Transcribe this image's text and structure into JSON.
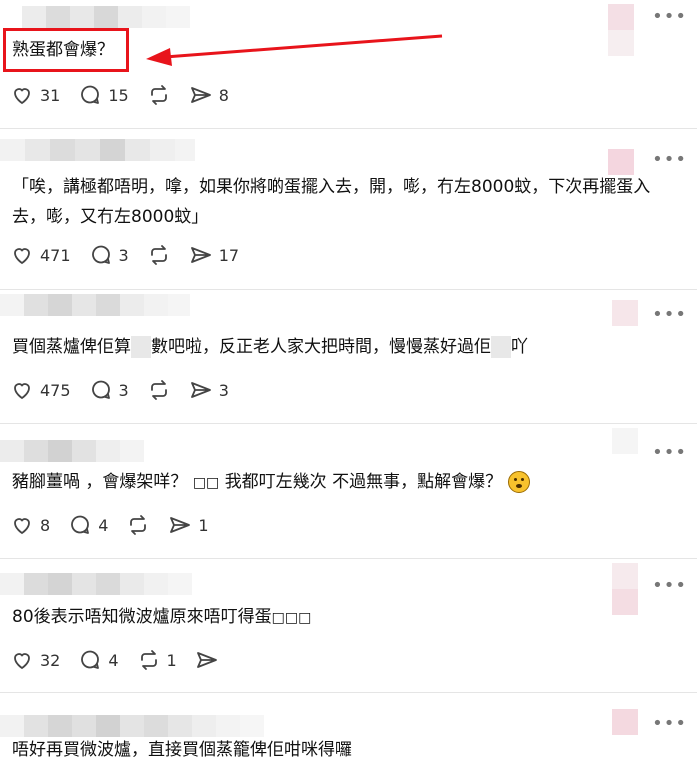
{
  "posts": [
    {
      "text": "熟蛋都會爆？",
      "likes": "31",
      "replies": "15",
      "reposts": "",
      "shares": "8"
    },
    {
      "text": "「唉，講極都唔明，嗱，如果你將啲蛋擺入去，開，嘭，冇左8000蚊，下次再擺蛋入去，嘭，又冇左8000蚊」",
      "likes": "471",
      "replies": "3",
      "reposts": "",
      "shares": "17"
    },
    {
      "text_a": "買個蒸爐俾佢算",
      "text_b": "數吧啦，反正老人家大把時間，慢慢蒸好過佢",
      "text_c": "吖",
      "likes": "475",
      "replies": "3",
      "reposts": "",
      "shares": "3"
    },
    {
      "text": "豬腳薑喎 ，會爆架咩？",
      "text_b": "我都叮左幾次 不過無事，點解會爆？",
      "likes": "8",
      "replies": "4",
      "reposts": "",
      "shares": "1"
    },
    {
      "text": "80後表示唔知微波爐原來唔叮得蛋",
      "likes": "32",
      "replies": "4",
      "reposts": "1",
      "shares": ""
    },
    {
      "text": "唔好再買微波爐，直接買個蒸籠俾佢咁咪得囉"
    }
  ],
  "icons": {
    "like": "heart-icon",
    "reply": "comment-icon",
    "repost": "repost-icon",
    "share": "send-icon",
    "more": "more-dots-icon"
  },
  "colors": {
    "highlight": "#e8141b",
    "divider": "#e5e5e5",
    "icon": "#444444"
  }
}
